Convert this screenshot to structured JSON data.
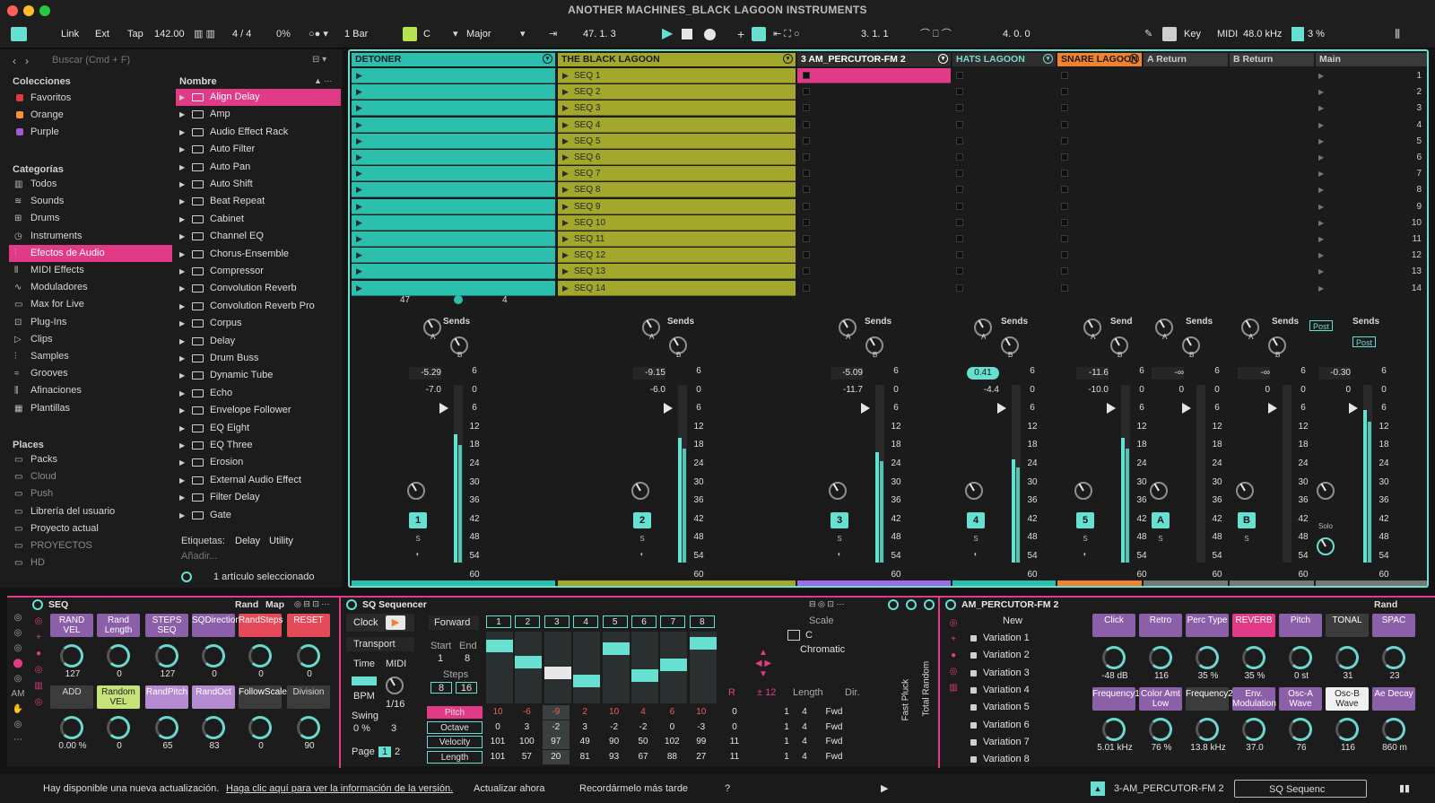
{
  "window": {
    "title": "ANOTHER MACHINES_BLACK LAGOON INSTRUMENTS"
  },
  "control": {
    "link": "Link",
    "ext": "Ext",
    "tap": "Tap",
    "tempo": "142.00",
    "signature": "4 / 4",
    "cpu": "0%",
    "quant": "1 Bar",
    "key_root": "C",
    "key_scale": "Major",
    "position": "47.  1.  3",
    "loop_start": "3.  1.  1",
    "loop_len": "4.  0.  0",
    "key_label": "Key",
    "midi_label": "MIDI",
    "sample_rate": "48.0 kHz",
    "cpu2": "3 %"
  },
  "browser": {
    "search": "Buscar (Cmd + F)",
    "col_header": "Nombre",
    "sections": {
      "collections": "Colecciones",
      "categories": "Categorías",
      "places": "Places"
    },
    "collections": [
      {
        "label": "Favoritos",
        "color": "#e5393f"
      },
      {
        "label": "Orange",
        "color": "#f29437"
      },
      {
        "label": "Purple",
        "color": "#a05ad4"
      }
    ],
    "categories": [
      {
        "label": "Todos",
        "icon": "▥"
      },
      {
        "label": "Sounds",
        "icon": "≋"
      },
      {
        "label": "Drums",
        "icon": "⊞"
      },
      {
        "label": "Instruments",
        "icon": "◷"
      },
      {
        "label": "Efectos de Audio",
        "icon": "⫶"
      },
      {
        "label": "MIDI Effects",
        "icon": "⫴"
      },
      {
        "label": "Moduladores",
        "icon": "∿"
      },
      {
        "label": "Max for Live",
        "icon": "▭"
      },
      {
        "label": "Plug-Ins",
        "icon": "⊡"
      },
      {
        "label": "Clips",
        "icon": "▷"
      },
      {
        "label": "Samples",
        "icon": "⫶"
      },
      {
        "label": "Grooves",
        "icon": "≈"
      },
      {
        "label": "Afinaciones",
        "icon": "⫼"
      },
      {
        "label": "Plantillas",
        "icon": "▦"
      }
    ],
    "places": [
      {
        "label": "Packs"
      },
      {
        "label": "Cloud"
      },
      {
        "label": "Push"
      },
      {
        "label": "Librería del usuario"
      },
      {
        "label": "Proyecto actual"
      },
      {
        "label": "PROYECTOS"
      },
      {
        "label": "HD"
      }
    ],
    "items": [
      "Align Delay",
      "Amp",
      "Audio Effect Rack",
      "Auto Filter",
      "Auto Pan",
      "Auto Shift",
      "Beat Repeat",
      "Cabinet",
      "Channel EQ",
      "Chorus-Ensemble",
      "Compressor",
      "Convolution Reverb",
      "Convolution Reverb Pro",
      "Corpus",
      "Delay",
      "Drum Buss",
      "Dynamic Tube",
      "Echo",
      "Envelope Follower",
      "EQ Eight",
      "EQ Three",
      "Erosion",
      "External Audio Effect",
      "Filter Delay",
      "Gate"
    ],
    "tags_label": "Etiquetas:",
    "tags": [
      "Delay",
      "Utility"
    ],
    "add_label": "Añadir...",
    "selection_info": "1 artículo seleccionado"
  },
  "tracks": [
    {
      "name": "DETONER",
      "color": "#2bbfae",
      "text": "#1a1a1a",
      "vol": "-5.29",
      "peak": "-7.0",
      "num": "1"
    },
    {
      "name": "THE BLACK LAGOON",
      "color": "#a3a82d",
      "text": "#1a1a1a",
      "vol": "-9.15",
      "peak": "-6.0",
      "num": "2"
    },
    {
      "name": "3 AM_PERCUTOR-FM 2",
      "color": "#2e2e2e",
      "text": "#ffffff",
      "vol": "-5.09",
      "peak": "-11.7",
      "num": "3"
    },
    {
      "name": "HATS LAGOON",
      "color": "#2e2e2e",
      "text": "#7fd6cc",
      "vol": "0.41",
      "peak": "-4.4",
      "num": "4"
    },
    {
      "name": "SNARE LAGOON",
      "color": "#f0812f",
      "text": "#1a1a1a",
      "vol": "-11.6",
      "peak": "-10.0",
      "num": "5"
    },
    {
      "name": "A Return",
      "color": "#3a3a3a",
      "text": "#cfcfcf",
      "vol": "-∞",
      "peak": "0",
      "num": "A"
    },
    {
      "name": "B Return",
      "color": "#3a3a3a",
      "text": "#cfcfcf",
      "vol": "-∞",
      "peak": "0",
      "num": "B"
    },
    {
      "name": "Main",
      "color": "#3a3a3a",
      "text": "#cfcfcf",
      "vol": "-0.30",
      "peak": "0",
      "num": ""
    }
  ],
  "clips": [
    "SEQ 1",
    "SEQ 2",
    "SEQ 3",
    "SEQ 4",
    "SEQ 5",
    "SEQ 6",
    "SEQ 7",
    "SEQ 8",
    "SEQ 9",
    "SEQ 10",
    "SEQ 11",
    "SEQ 12",
    "SEQ 13",
    "SEQ 14"
  ],
  "scenes": [
    "1",
    "2",
    "3",
    "4",
    "5",
    "6",
    "7",
    "8",
    "9",
    "10",
    "11",
    "12",
    "13",
    "14"
  ],
  "mixer": {
    "sends": "Sends",
    "send_short": "Send",
    "a": "A",
    "b": "B",
    "post": "Post",
    "s": "S",
    "solo": "Solo",
    "scale": [
      "6",
      "0",
      "6",
      "12",
      "18",
      "24",
      "30",
      "36",
      "42",
      "48",
      "54",
      "60"
    ],
    "track1_readout_a": "47",
    "track1_readout_b": "4"
  },
  "seq": {
    "title": "SEQ",
    "rand": "Rand",
    "map": "Map",
    "row1": [
      "RAND VEL",
      "Rand Length",
      "STEPS SEQ",
      "SQDirection",
      "RandSteps",
      "RESET"
    ],
    "row1_vals": [
      "127",
      "0",
      "127",
      "0",
      "0",
      "0"
    ],
    "row2": [
      "ADD",
      "Random VEL",
      "RandPitch",
      "RandOct",
      "FollowScales",
      "Division"
    ],
    "row2_vals": [
      "0.00 %",
      "0",
      "65",
      "83",
      "0",
      "90"
    ]
  },
  "sq": {
    "title": "SQ Sequencer",
    "clock": "Clock",
    "transport": "Transport",
    "time": "Time",
    "midi": "MIDI",
    "bpm": "BPM",
    "rate": "1/16",
    "swing": "Swing",
    "swing_val": "0 %",
    "three": "3",
    "page": "Page",
    "pages": [
      "1",
      "2"
    ],
    "direction": "Forward",
    "start": "Start",
    "end": "End",
    "start_val": "1",
    "end_val": "8",
    "steps_label": "Steps",
    "steps": [
      "8",
      "16"
    ],
    "step_nums": [
      "1",
      "2",
      "3",
      "4",
      "5",
      "6",
      "7",
      "8"
    ],
    "scale_label": "Scale",
    "root": "C",
    "mode": "Chromatic",
    "transpose": "± 12",
    "r": "R",
    "length_col": "Length",
    "dir_col": "Dir.",
    "rows": [
      {
        "label": "Pitch",
        "vals": [
          "10",
          "-6",
          "-9",
          "2",
          "10",
          "4",
          "6",
          "10"
        ],
        "extra": "0"
      },
      {
        "label": "Octave",
        "vals": [
          "0",
          "3",
          "-2",
          "3",
          "-2",
          "-2",
          "0",
          "-3"
        ],
        "extra": "0"
      },
      {
        "label": "Velocity",
        "vals": [
          "101",
          "100",
          "97",
          "49",
          "90",
          "50",
          "102",
          "99"
        ],
        "extra": "11"
      },
      {
        "label": "Length",
        "vals": [
          "101",
          "57",
          "20",
          "81",
          "93",
          "67",
          "88",
          "27"
        ],
        "extra": "11"
      }
    ],
    "lens": [
      "1",
      "4"
    ],
    "fwd": "Fwd",
    "bars": [
      0.85,
      0.55,
      0.35,
      0.2,
      0.8,
      0.3,
      0.5,
      0.9
    ],
    "side": [
      "Fast Pluck",
      "Total Random"
    ]
  },
  "am": {
    "title": "AM_PERCUTOR-FM 2",
    "rand": "Rand",
    "new": "New",
    "variations": [
      "Variation 1",
      "Variation 2",
      "Variation 3",
      "Variation 4",
      "Variation 5",
      "Variation 6",
      "Variation 7",
      "Variation 8"
    ],
    "row1": [
      "Click",
      "Retro",
      "Perc Type",
      "REVERB",
      "Pitch",
      "TONAL",
      "SPAC"
    ],
    "row1_vals": [
      "-48 dB",
      "116",
      "35 %",
      "35 %",
      "0 st",
      "31",
      "23"
    ],
    "row2": [
      "Frequency1",
      "Color Amt Low",
      "Frequency2",
      "Env. Modulation",
      "Osc-A Wave",
      "Osc-B Wave",
      "Ae Decay"
    ],
    "row2_vals": [
      "5.01 kHz",
      "76 %",
      "13.8 kHz",
      "37.0",
      "76",
      "116",
      "860 m"
    ]
  },
  "status": {
    "message": "Hay disponible una nueva actualización.",
    "link": "Haga clic aquí para ver la información de la versión.",
    "update_now": "Actualizar ahora",
    "remind": "Recordármelo más tarde",
    "help": "?",
    "track_name": "3-AM_PERCUTOR-FM 2",
    "device_name": "SQ Sequenc"
  },
  "colors": {
    "accent": "#e13b87",
    "teal": "#67e0d2",
    "olive": "#a3a82d",
    "orange": "#f0812f"
  }
}
